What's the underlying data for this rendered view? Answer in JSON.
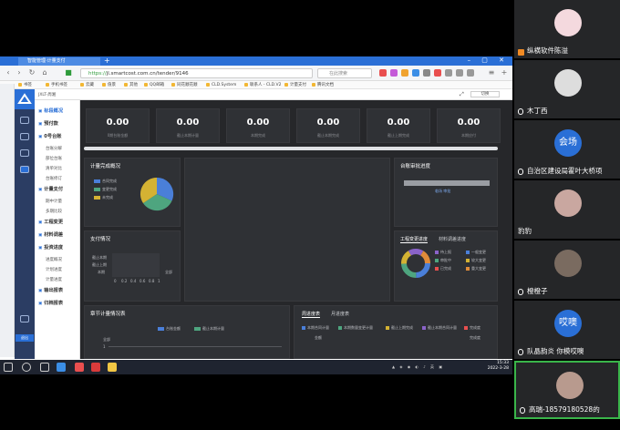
{
  "browser": {
    "tab_title": "智能管理·计量支付",
    "url_scheme": "https://",
    "url_rest": "jl.smartcost.com.cn/tender/9146",
    "search_placeholder": "在此搜索",
    "bookmarks": [
      "书签",
      "手机书签",
      "云藏",
      "值景",
      "其他",
      "QQ邮箱",
      "同花顺花顺",
      "CLD.System",
      "联系人 - CLD.V2",
      "计量支付",
      "腾讯文档"
    ]
  },
  "app": {
    "top_left": "JXLT-周湘",
    "top_right": "切换",
    "side_footer": "退出",
    "menu": [
      {
        "label": "标段概况",
        "type": "head"
      },
      {
        "label": "预付款",
        "type": "head"
      },
      {
        "label": "0号台账",
        "type": "head"
      },
      {
        "label": "台账分解",
        "type": "sub"
      },
      {
        "label": "部位台账",
        "type": "sub"
      },
      {
        "label": "清单对比",
        "type": "sub"
      },
      {
        "label": "台账修订",
        "type": "sub"
      },
      {
        "label": "计量支付",
        "type": "head"
      },
      {
        "label": "期中计量",
        "type": "sub"
      },
      {
        "label": "多期比较",
        "type": "sub"
      },
      {
        "label": "工程变更",
        "type": "head"
      },
      {
        "label": "材料调差",
        "type": "head"
      },
      {
        "label": "投资进度",
        "type": "head"
      },
      {
        "label": "进度概况",
        "type": "sub"
      },
      {
        "label": "计划进度",
        "type": "sub"
      },
      {
        "label": "计量进度",
        "type": "sub"
      },
      {
        "label": "输出报表",
        "type": "head"
      },
      {
        "label": "归档报表",
        "type": "head"
      }
    ],
    "stats": [
      {
        "value": "0.00",
        "label": "0期台账金额"
      },
      {
        "value": "0.00",
        "label": "截止本期计量"
      },
      {
        "value": "0.00",
        "label": "本期完成"
      },
      {
        "value": "0.00",
        "label": "截止本期完成"
      },
      {
        "value": "0.00",
        "label": "截止上期完成"
      },
      {
        "value": "0.00",
        "label": "本期应付"
      }
    ],
    "panels": {
      "measure_title": "计量完成概况",
      "measure_legend": [
        "合同完成",
        "变更完成",
        "未完成"
      ],
      "payment_title": "支付情况",
      "payment_rows": [
        "截止本期",
        "截止上期",
        "本期"
      ],
      "payment_axis": [
        "0",
        "0.2",
        "0.4",
        "0.6",
        "0.8",
        "1"
      ],
      "payment_right": "全部",
      "ledger_title": "台账审批进度",
      "ledger_sub": "临场 审批",
      "change_tabs": [
        "工程变更进度",
        "材料调差进度"
      ],
      "change_legend": [
        "待上报",
        "一般变更",
        "审批中",
        "较大变更",
        "已完成",
        "重大变更"
      ],
      "chapter_title": "章节计量情况表",
      "chapter_legend": [
        "台账金额",
        "截止本期计量"
      ],
      "chapter_axis_top": "全部",
      "chapter_axis_val": "1",
      "progress_tabs": [
        "周进度表",
        "月进度表"
      ],
      "progress_legend": [
        "本期合同计量",
        "本期数量变更计量",
        "截止上期完成",
        "截止本期合同计量",
        "完成度"
      ],
      "progress_axis_left": "金额",
      "progress_axis_right": "完成度"
    }
  },
  "taskbar": {
    "time": "15:33",
    "date": "2022-3-28"
  },
  "participants": [
    {
      "name": "纵横软件陈溢",
      "mic": true
    },
    {
      "name": "木丁西",
      "mic": false
    },
    {
      "name": "自治区建设局霍叶大桥项",
      "mic": true,
      "avatar_text": "会场"
    },
    {
      "name": "豹豹",
      "mic": false
    },
    {
      "name": "橙橙子",
      "mic": true
    },
    {
      "name": "队晶韵炎 你模哎噢",
      "mic": true,
      "avatar_text": "哎噢"
    },
    {
      "name": "高瑞-18579180528的",
      "mic": true
    }
  ],
  "colors": {
    "accent": "#2a6fd6",
    "blue": "#4a7fd9",
    "green": "#4ea57f",
    "yellow": "#d4b233",
    "purple": "#8a63c9",
    "orange": "#e08b3a"
  }
}
